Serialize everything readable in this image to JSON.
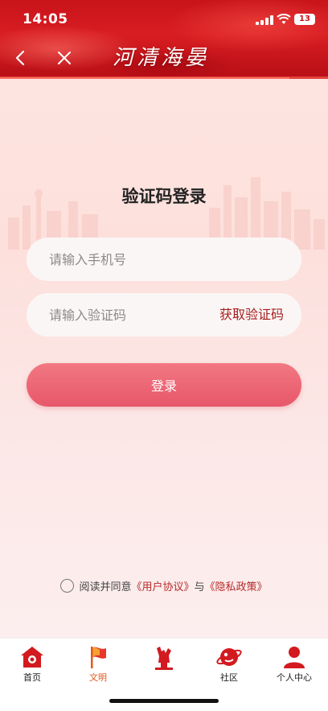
{
  "status_bar": {
    "time": "14:05",
    "battery": "13"
  },
  "header": {
    "title": "河清海晏"
  },
  "login": {
    "heading": "验证码登录",
    "phone_placeholder": "请输入手机号",
    "code_placeholder": "请输入验证码",
    "get_code_label": "获取验证码",
    "submit_label": "登录"
  },
  "agreement": {
    "prefix": "阅读并同意",
    "user_agreement": "《用户协议》",
    "conjunction": "与",
    "privacy_policy": "《隐私政策》"
  },
  "tabbar": {
    "items": [
      {
        "label": "首页",
        "icon": "home-icon"
      },
      {
        "label": "文明",
        "icon": "flag-icon",
        "active": true
      },
      {
        "label": "",
        "icon": "monument-icon"
      },
      {
        "label": "社区",
        "icon": "planet-icon"
      },
      {
        "label": "个人中心",
        "icon": "person-icon"
      }
    ]
  },
  "colors": {
    "brand_red": "#c8141a",
    "link_red": "#a61d1d",
    "button_pink": "#ec6576",
    "active_tab": "#e05a1e"
  }
}
